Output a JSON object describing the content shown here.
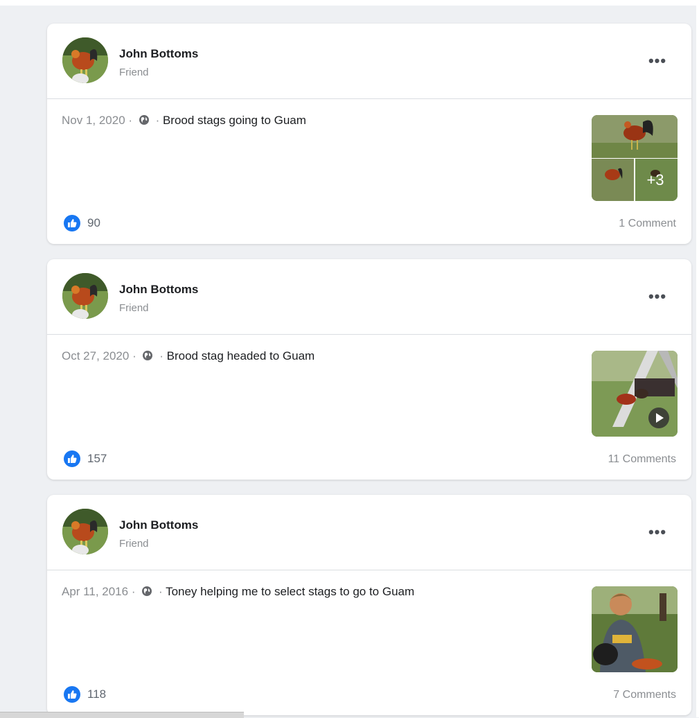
{
  "posts": [
    {
      "author": "John Bottoms",
      "relation": "Friend",
      "date": "Nov 1, 2020",
      "separator": "·",
      "caption": "Brood stags going to Guam",
      "likes": "90",
      "comments": "1 Comment",
      "thumbnail": {
        "type": "photo-grid",
        "overlay": "+3"
      }
    },
    {
      "author": "John Bottoms",
      "relation": "Friend",
      "date": "Oct 27, 2020",
      "separator": "·",
      "caption": "Brood stag headed to Guam",
      "likes": "157",
      "comments": "11 Comments",
      "thumbnail": {
        "type": "video",
        "overlay": "play-icon"
      }
    },
    {
      "author": "John Bottoms",
      "relation": "Friend",
      "date": "Apr 11, 2016",
      "separator": "·",
      "caption": "Toney helping me to select stags to go to Guam",
      "likes": "118",
      "comments": "7 Comments",
      "thumbnail": {
        "type": "photo",
        "overlay": ""
      }
    }
  ],
  "icons": {
    "more": "more-options-icon",
    "privacy": "globe-icon",
    "like": "like-icon"
  },
  "colors": {
    "background": "#eef0f3",
    "card": "#ffffff",
    "like_blue": "#1877f2",
    "secondary_text": "#8a8d91"
  },
  "more_glyph": "•••"
}
